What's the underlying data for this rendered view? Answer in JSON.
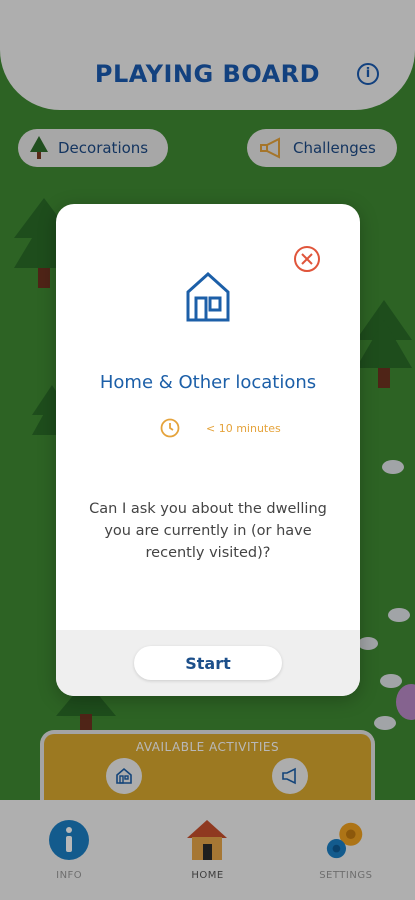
{
  "header": {
    "title": "PLAYING BOARD",
    "info_icon": "info-icon"
  },
  "board": {
    "decorations_label": "Decorations",
    "challenges_label": "Challenges"
  },
  "activities": {
    "label": "AVAILABLE ACTIVITIES"
  },
  "modal": {
    "title": "Home & Other locations",
    "duration": "< 10 minutes",
    "question": "Can I ask you about the dwelling you are currently in (or have recently visited)?",
    "start_label": "Start"
  },
  "nav": {
    "items": [
      {
        "label": "INFO",
        "icon": "info-icon"
      },
      {
        "label": "HOME",
        "icon": "house-icon"
      },
      {
        "label": "SETTINGS",
        "icon": "gears-icon"
      }
    ]
  },
  "colors": {
    "brand_blue": "#1a5ab0",
    "grass": "#3f8a33",
    "close_red": "#e0553b",
    "duration_orange": "#e5a33b",
    "activities_gold": "#d9a82e"
  }
}
